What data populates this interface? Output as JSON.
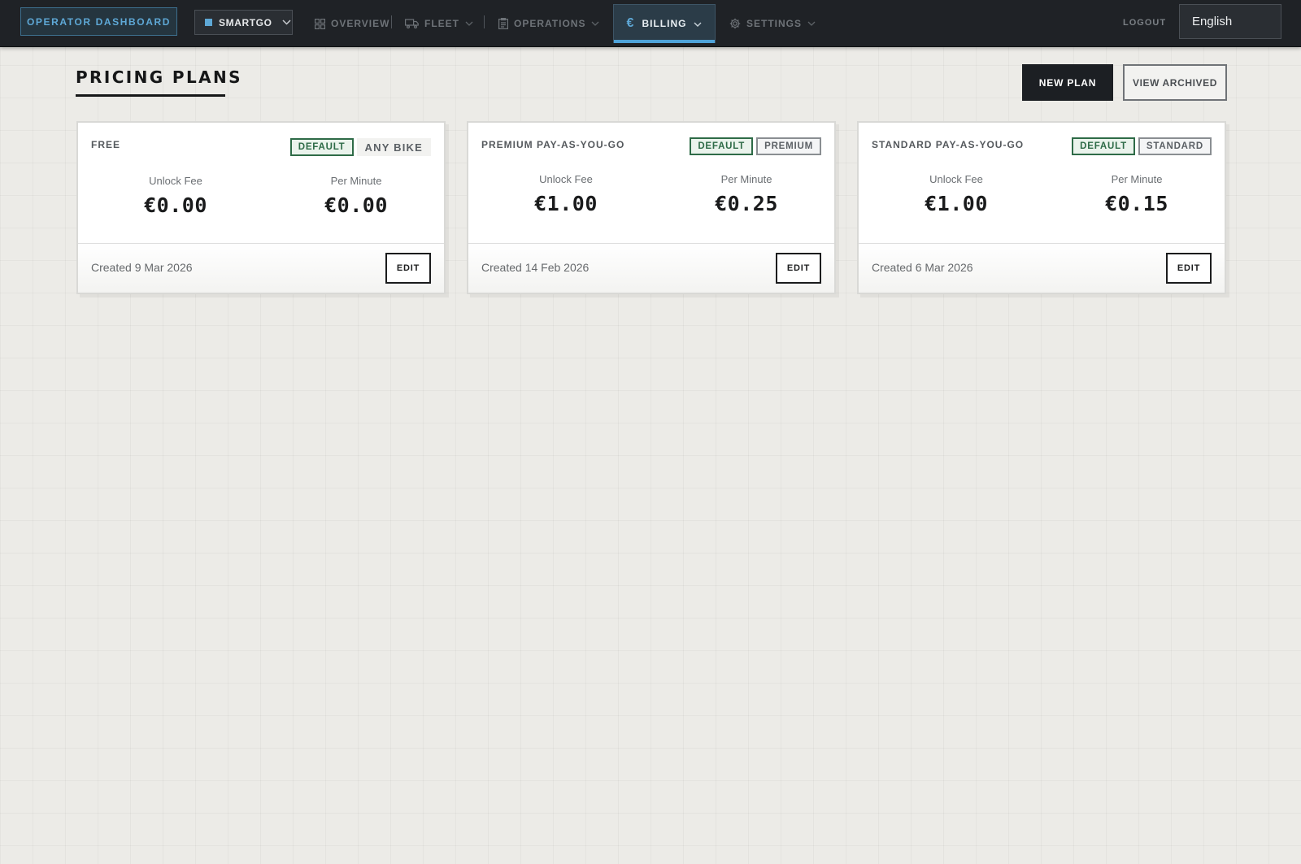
{
  "nav": {
    "brand": "OPERATOR DASHBOARD",
    "org": "SMARTGO",
    "items": [
      {
        "label": "OVERVIEW",
        "icon": "grid-icon"
      },
      {
        "label": "FLEET",
        "icon": "truck-icon"
      },
      {
        "label": "OPERATIONS",
        "icon": "clipboard-icon"
      },
      {
        "label": "BILLING",
        "icon": "euro-icon"
      },
      {
        "label": "SETTINGS",
        "icon": "gear-icon"
      }
    ],
    "active": "BILLING",
    "logout": "LOGOUT",
    "language": "English"
  },
  "page": {
    "title": "PRICING PLANS",
    "new_plan": "NEW PLAN",
    "view_archived": "VIEW ARCHIVED"
  },
  "labels": {
    "unlock_fee": "Unlock Fee",
    "per_minute": "Per Minute",
    "edit": "EDIT"
  },
  "plans": [
    {
      "name": "FREE",
      "badges": [
        "DEFAULT",
        "ANY BIKE"
      ],
      "unlock_fee": "€0.00",
      "per_minute": "€0.00",
      "created": "Created 9 Mar 2026"
    },
    {
      "name": "PREMIUM PAY-AS-YOU-GO",
      "badges": [
        "DEFAULT",
        "PREMIUM"
      ],
      "unlock_fee": "€1.00",
      "per_minute": "€0.25",
      "created": "Created 14 Feb 2026"
    },
    {
      "name": "STANDARD PAY-AS-YOU-GO",
      "badges": [
        "DEFAULT",
        "STANDARD"
      ],
      "unlock_fee": "€1.00",
      "per_minute": "€0.15",
      "created": "Created 6 Mar 2026"
    }
  ],
  "colors": {
    "nav_bg": "#1f2226",
    "accent": "#4ea3d9",
    "default_badge": "#2e6b47",
    "page_bg": "#ecebe7"
  }
}
